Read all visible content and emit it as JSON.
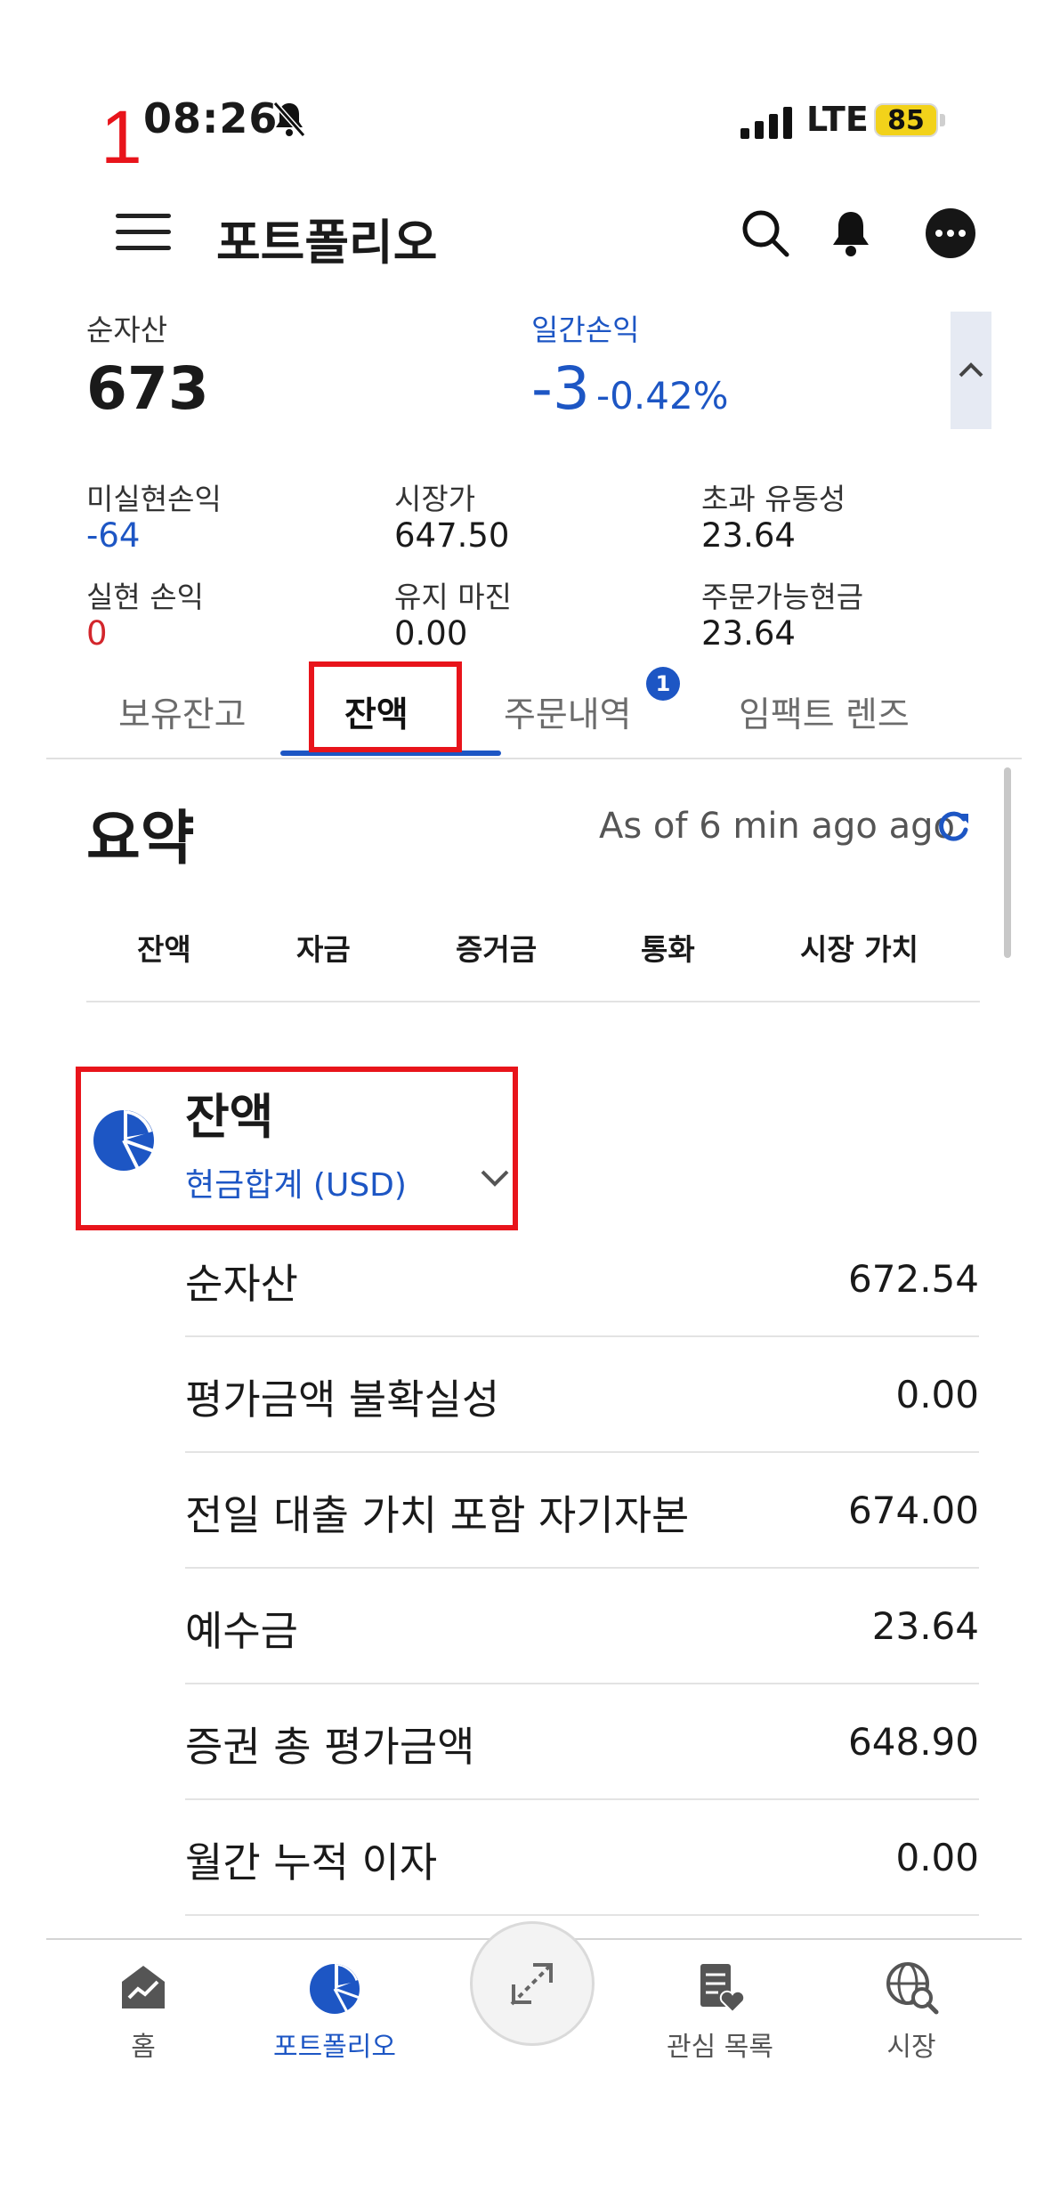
{
  "annotation": {
    "marker": "1",
    "highlight_color": "#e8141b"
  },
  "status_bar": {
    "time": "08:26",
    "network": "LTE",
    "battery": "85",
    "bell_icon": "bell-slash-icon"
  },
  "header": {
    "title": "포트폴리오",
    "icons": [
      "menu-icon",
      "search-icon",
      "bell-icon",
      "more-icon"
    ]
  },
  "summary": {
    "net_assets_label": "순자산",
    "net_assets_value": "673",
    "daily_pl_label": "일간손익",
    "daily_pl_value": "-3",
    "daily_pl_pct": "-0.42%",
    "metrics": [
      {
        "label": "미실현손익",
        "value": "-64",
        "color": "blue"
      },
      {
        "label": "시장가",
        "value": "647.50",
        "color": "default"
      },
      {
        "label": "초과 유동성",
        "value": "23.64",
        "color": "default"
      },
      {
        "label": "실현 손익",
        "value": "0",
        "color": "red"
      },
      {
        "label": "유지 마진",
        "value": "0.00",
        "color": "default"
      },
      {
        "label": "주문가능현금",
        "value": "23.64",
        "color": "default"
      }
    ]
  },
  "tabs": [
    {
      "label": "보유잔고",
      "active": false
    },
    {
      "label": "잔액",
      "active": true
    },
    {
      "label": "주문내역",
      "active": false,
      "badge": "1"
    },
    {
      "label": "임팩트 렌즈",
      "active": false
    }
  ],
  "section": {
    "title": "요약",
    "as_of": "As of 6 min ago ago",
    "subtabs": [
      "잔액",
      "자금",
      "증거금",
      "통화",
      "시장 가치"
    ]
  },
  "balance_group": {
    "title": "잔액",
    "selector": "현금합계 (USD)",
    "rows": [
      {
        "label": "순자산",
        "value": "672.54"
      },
      {
        "label": "평가금액 불확실성",
        "value": "0.00"
      },
      {
        "label": "전일 대출 가치 포함 자기자본",
        "value": "674.00"
      },
      {
        "label": "예수금",
        "value": "23.64"
      },
      {
        "label": "증권 총 평가금액",
        "value": "648.90"
      },
      {
        "label": "월간 누적 이자",
        "value": "0.00"
      }
    ]
  },
  "bottom_nav": [
    {
      "label": "홈",
      "icon": "home-chart-icon",
      "active": false
    },
    {
      "label": "포트폴리오",
      "icon": "pie-chart-icon",
      "active": true
    },
    {
      "label": "",
      "icon": "trade-arrows-icon",
      "active": false
    },
    {
      "label": "관심 목록",
      "icon": "watchlist-icon",
      "active": false
    },
    {
      "label": "시장",
      "icon": "globe-search-icon",
      "active": false
    }
  ],
  "colors": {
    "accent": "#1d56c4",
    "negative_red": "#d3262c",
    "text": "#1a1a1a"
  }
}
